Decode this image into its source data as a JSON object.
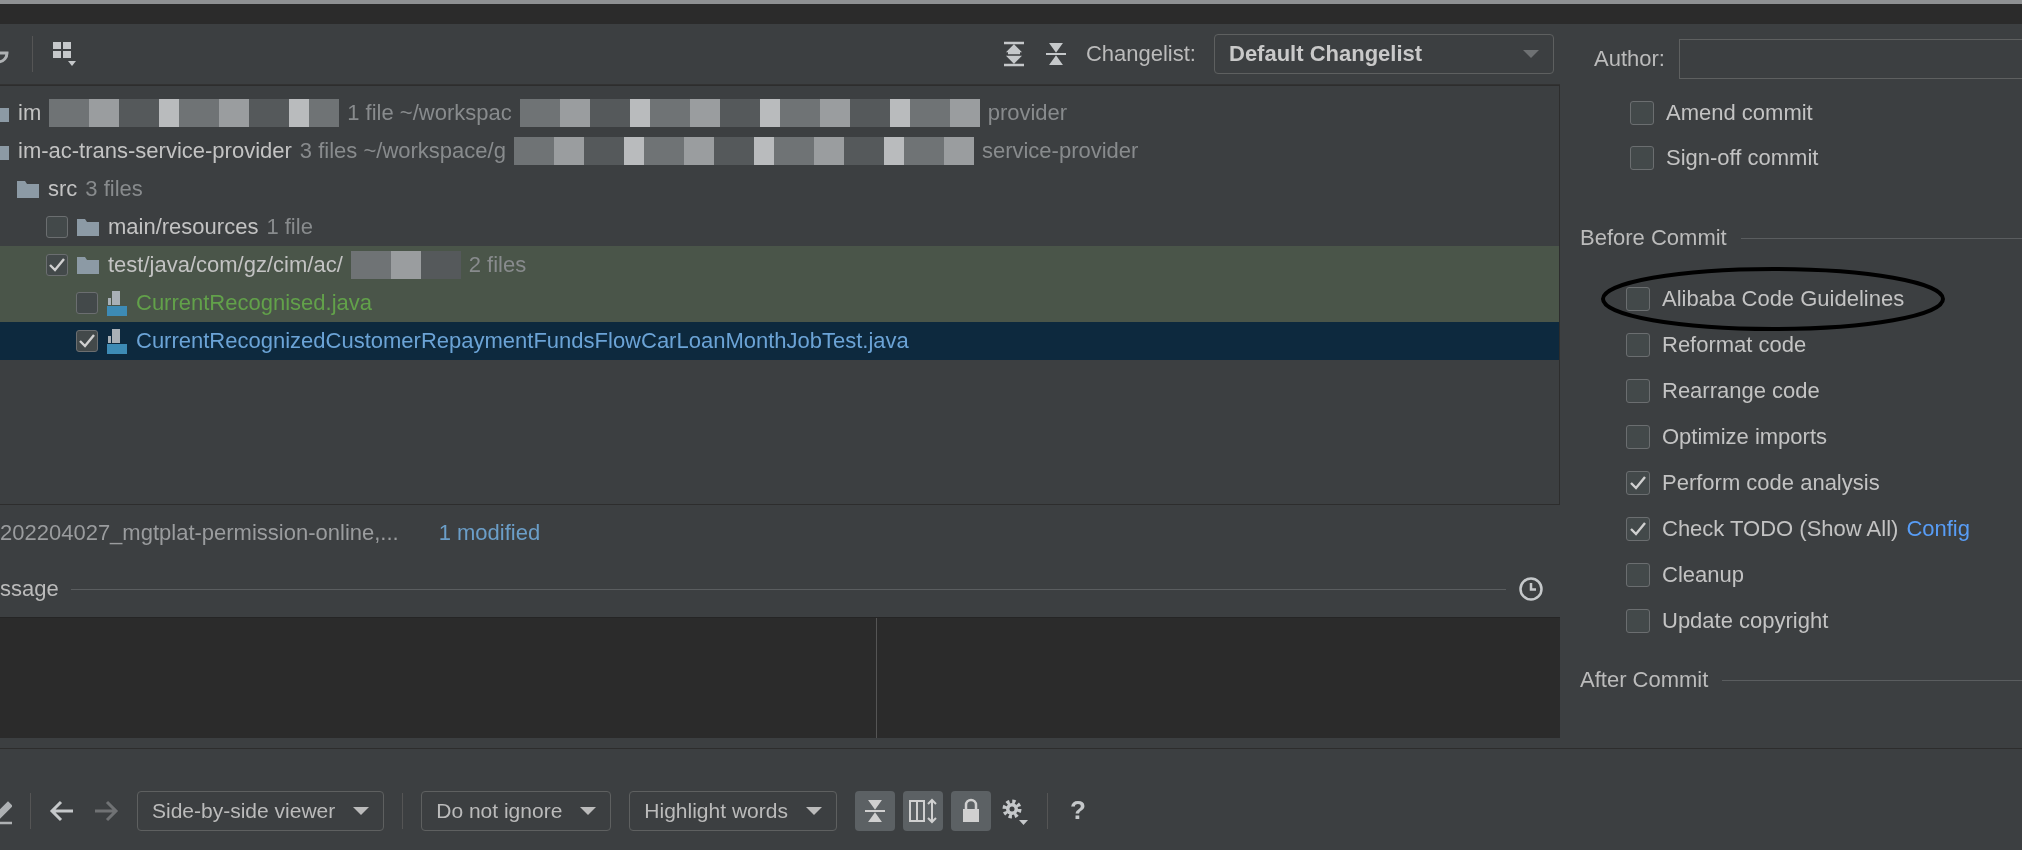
{
  "toolbar": {
    "changelist_label": "Changelist:",
    "changelist": "Default Changelist"
  },
  "tree": [
    {
      "kind": "module",
      "selected": false,
      "highlighted": false,
      "parts": [
        {
          "kind": "text",
          "text": "im"
        },
        {
          "kind": "redacted"
        },
        {
          "kind": "count",
          "text": "1 file ~/workspac"
        },
        {
          "kind": "redacted"
        },
        {
          "kind": "count",
          "text": "provider"
        }
      ]
    },
    {
      "kind": "module",
      "selected": false,
      "highlighted": false,
      "parts": [
        {
          "kind": "text",
          "text": "im-ac-trans-service-provider"
        },
        {
          "kind": "count",
          "text": "3 files ~/workspace/g"
        },
        {
          "kind": "redacted"
        },
        {
          "kind": "count",
          "text": "service-provider"
        }
      ],
      "children": [
        {
          "kind": "folder",
          "selected": false,
          "highlighted": false,
          "parts": [
            {
              "kind": "text",
              "text": "src"
            },
            {
              "kind": "count",
              "text": "3 files"
            }
          ],
          "children": [
            {
              "kind": "folder",
              "selected": false,
              "highlighted": false,
              "checked": false,
              "parts": [
                {
                  "kind": "text",
                  "text": "main/resources"
                },
                {
                  "kind": "count",
                  "text": "1 file"
                }
              ]
            },
            {
              "kind": "folder",
              "selected": false,
              "highlighted": true,
              "checked": true,
              "parts": [
                {
                  "kind": "text",
                  "text": "test/java/com/gz/cim/ac/"
                },
                {
                  "kind": "redacted"
                },
                {
                  "kind": "count",
                  "text": "2 files"
                }
              ],
              "children": [
                {
                  "kind": "file",
                  "color": "#62a14a",
                  "selected": false,
                  "highlighted": true,
                  "checked": false,
                  "parts": [
                    {
                      "kind": "text",
                      "text": "CurrentRecognised.java"
                    }
                  ]
                },
                {
                  "kind": "file",
                  "color": "#6ba3d6",
                  "selected": true,
                  "highlighted": false,
                  "checked": true,
                  "parts": [
                    {
                      "kind": "text",
                      "text": "CurrentRecognizedCustomerRepaymentFundsFlowCarLoanMonthJobTest.java"
                    }
                  ]
                }
              ]
            }
          ]
        }
      ]
    }
  ],
  "status": {
    "branch": "202204027_mgtplat-permission-online,...",
    "summary": "1 modified"
  },
  "message": {
    "label": "ssage"
  },
  "diff_toolbar": {
    "viewer": "Side-by-side viewer",
    "ignore": "Do not ignore",
    "highlight": "Highlight words",
    "help": "?"
  },
  "author": {
    "label": "Author:"
  },
  "options": [
    {
      "label": "Amend commit",
      "checked": false
    },
    {
      "label": "Sign-off commit",
      "checked": false
    }
  ],
  "before_commit": {
    "title": "Before Commit",
    "items": [
      {
        "label": "Alibaba Code Guidelines",
        "checked": false,
        "circled": true
      },
      {
        "label": "Reformat code",
        "checked": false,
        "circled": false
      },
      {
        "label": "Rearrange code",
        "checked": false,
        "circled": false
      },
      {
        "label": "Optimize imports",
        "checked": false,
        "circled": false
      },
      {
        "label": "Perform code analysis",
        "checked": true,
        "circled": false
      },
      {
        "label": "Check TODO (Show All)",
        "checked": true,
        "circled": false,
        "link": "Config"
      },
      {
        "label": "Cleanup",
        "checked": false,
        "circled": false
      },
      {
        "label": "Update copyright",
        "checked": false,
        "circled": false
      }
    ]
  },
  "after_commit": {
    "title": "After Commit"
  }
}
